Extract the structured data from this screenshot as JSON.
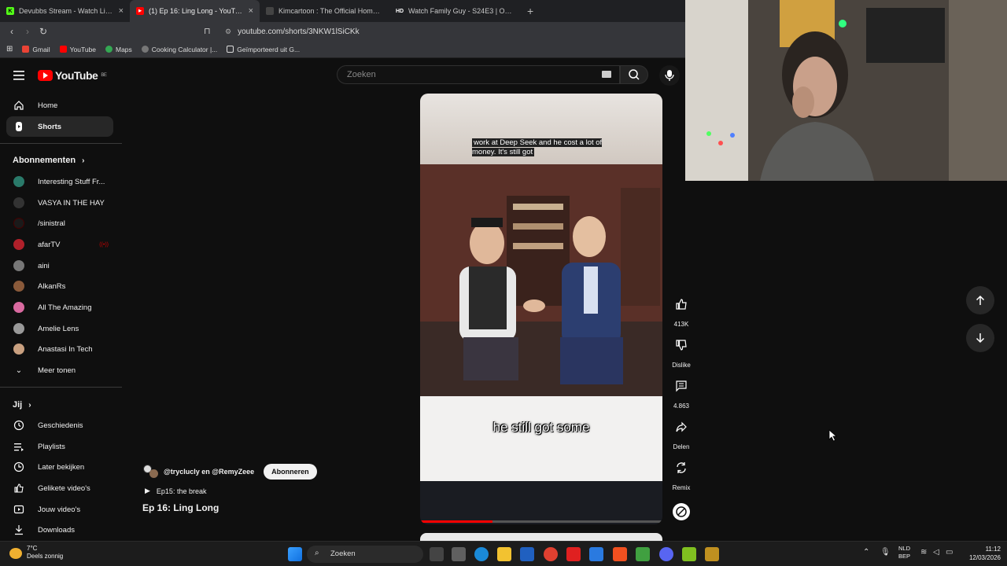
{
  "browser": {
    "tabs": [
      {
        "title": "Devubbs Stream - Watch Live on",
        "fav": "K",
        "fav_color": "#53fc18",
        "active": false
      },
      {
        "title": "(1) Ep 16: Ling Long - YouTube",
        "fav": "▶",
        "fav_color": "#ff0000",
        "active": true
      },
      {
        "title": "Kimcartoon : The Official Home | kim",
        "fav": "",
        "fav_color": "#444444",
        "active": false
      },
      {
        "title": "Watch Family Guy - S24E3 | Online H",
        "fav": "HD",
        "fav_color": "#1f2023",
        "active": false
      }
    ],
    "url": "youtube.com/shorts/3NKW1lSiCKk",
    "bookmarks": [
      {
        "label": "Gmail",
        "color": "#ea4335"
      },
      {
        "label": "YouTube",
        "color": "#ff0000"
      },
      {
        "label": "Maps",
        "color": "#34a853"
      },
      {
        "label": "Cooking Calculator |...",
        "color": "#777777"
      },
      {
        "label": "Geïmporteerd uit G...",
        "color": "#ffffff"
      }
    ]
  },
  "yt": {
    "logo": "YouTube",
    "region": "BE",
    "search_placeholder": "Zoeken"
  },
  "sidebar": {
    "home": "Home",
    "shorts": "Shorts",
    "subs_header": "Abonnementen",
    "subs": [
      {
        "label": "Interesting Stuff Fr...",
        "color": "#2a7a6a"
      },
      {
        "label": "VASYA IN THE HAY",
        "color": "#333333"
      },
      {
        "label": "/sinistral",
        "color": "#1a1a1a"
      },
      {
        "label": "afarTV",
        "color": "#b0202a"
      },
      {
        "label": "aini",
        "color": "#777777"
      },
      {
        "label": "AlkanRs",
        "color": "#8a5a3a"
      },
      {
        "label": "All The Amazing",
        "color": "#d96aa0"
      },
      {
        "label": "Amelie Lens",
        "color": "#999999"
      },
      {
        "label": "Anastasi In Tech",
        "color": "#c9a080"
      }
    ],
    "more": "Meer tonen",
    "you_header": "Jij",
    "you": [
      "Geschiedenis",
      "Playlists",
      "Later bekijken",
      "Gelikete video's",
      "Jouw video's",
      "Downloads"
    ]
  },
  "video": {
    "caption_top": "work at Deep Seek and he cost a lot of money. It's still got",
    "caption_big": "he still got some",
    "progress": 0.3,
    "channel": "@tryclucly en @RemyZeee",
    "subscribe": "Abonneren",
    "episode": "Ep15: the break",
    "title": "Ep 16: Ling Long"
  },
  "actions": {
    "likes": "413K",
    "dislike": "Dislike",
    "comments": "4.863",
    "share": "Delen",
    "remix": "Remix"
  },
  "taskbar": {
    "temp": "7°C",
    "weather": "Deels zonnig",
    "search": "Zoeken",
    "lang1": "NLD",
    "lang2": "BEP",
    "time": "11:12",
    "date": "12/03/2026"
  }
}
